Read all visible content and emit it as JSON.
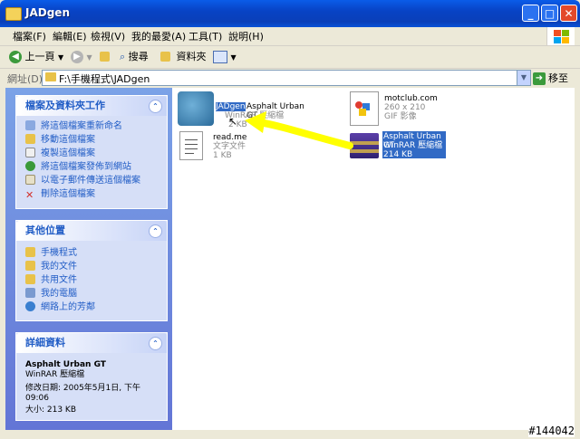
{
  "window": {
    "title": "JADgen",
    "min": "_",
    "max": "□",
    "close": "✕"
  },
  "menu": [
    "檔案(F)",
    "編輯(E)",
    "檢視(V)",
    "我的最愛(A)",
    "工具(T)",
    "說明(H)"
  ],
  "toolbar": {
    "back": "上一頁",
    "search": "搜尋",
    "folders": "資料夾"
  },
  "address": {
    "label": "網址(D)",
    "value": "F:\\手機程式\\JADgen",
    "go": "移至"
  },
  "tasks": {
    "title": "檔案及資料夾工作",
    "items": [
      "將這個檔案重新命名",
      "移動這個檔案",
      "複製這個檔案",
      "將這個檔案發佈到網站",
      "以電子郵件傳送這個檔案",
      "刪除這個檔案"
    ]
  },
  "places": {
    "title": "其他位置",
    "items": [
      "手機程式",
      "我的文件",
      "共用文件",
      "我的電腦",
      "網路上的芳鄰"
    ]
  },
  "details": {
    "title": "詳細資料",
    "name": "Asphalt Urban GT",
    "type": "WinRAR 壓縮檔",
    "modified": "修改日期: 2005年5月1日, 下午 09:06",
    "size": "大小: 213 KB"
  },
  "files": [
    {
      "name": "JADgen",
      "type": "Asphalt Urban GT",
      "sub": "WinRAR 壓縮檔",
      "size": "2 KB"
    },
    {
      "name": "motclub.com",
      "type": "260 x 210",
      "sub": "GIF 影像"
    },
    {
      "name": "read.me",
      "type": "文字文件",
      "sub": "1 KB"
    },
    {
      "name": "Asphalt Urban GT",
      "type": "WinRAR 壓縮檔",
      "sub": "214 KB"
    }
  ],
  "watermark": "#144042",
  "colors": {
    "title_blue": "#0a52d6",
    "selection": "#316ac5",
    "panel_link": "#215dc6",
    "annotation": "#ffff00"
  }
}
